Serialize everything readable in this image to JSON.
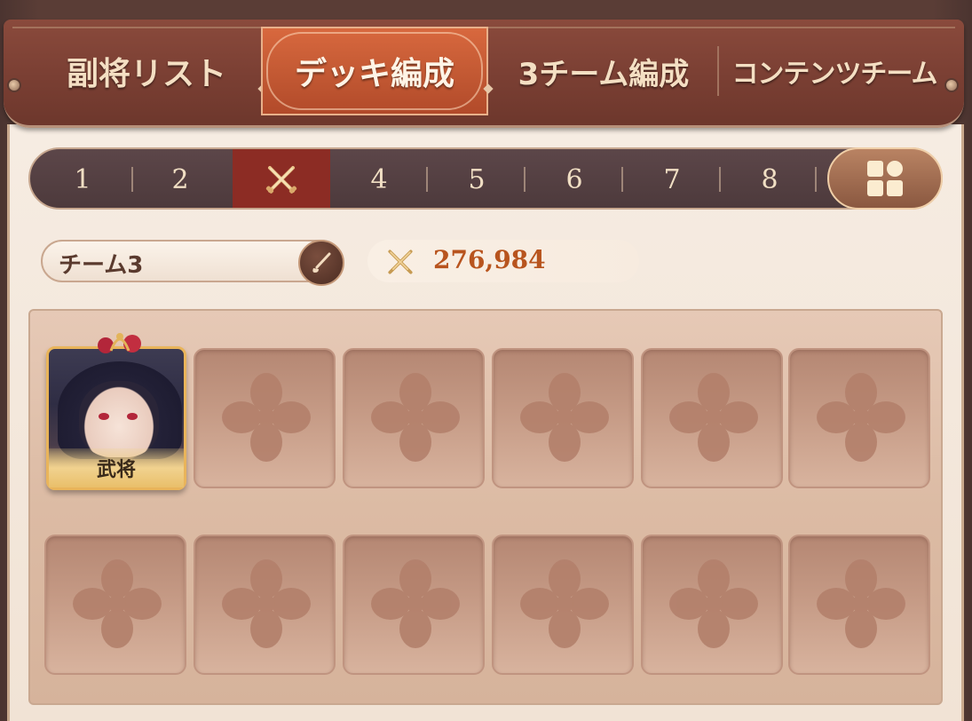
{
  "tabs": [
    {
      "label": "副将リスト",
      "active": false
    },
    {
      "label": "デッキ編成",
      "active": true
    },
    {
      "label": "3チーム編成",
      "active": false
    },
    {
      "label": "コンテンツチーム",
      "active": false
    }
  ],
  "decks": [
    "1",
    "2",
    "",
    "4",
    "5",
    "6",
    "7",
    "8"
  ],
  "active_deck_index": 2,
  "active_deck_icon": "crossed-swords-icon",
  "grid_button_icon": "grid-view-icon",
  "team": {
    "name": "チーム3",
    "power_icon": "crossed-swords-icon",
    "power": "276,984"
  },
  "slots": {
    "hero": {
      "label": "武将"
    },
    "empty_icon": "flower-emblem-icon",
    "rows": 2,
    "columns": 6
  },
  "colors": {
    "active_tab": "#c45a34",
    "active_deck": "#8c2c24",
    "power_value": "#b8541e",
    "frame": "#7a3f33"
  }
}
